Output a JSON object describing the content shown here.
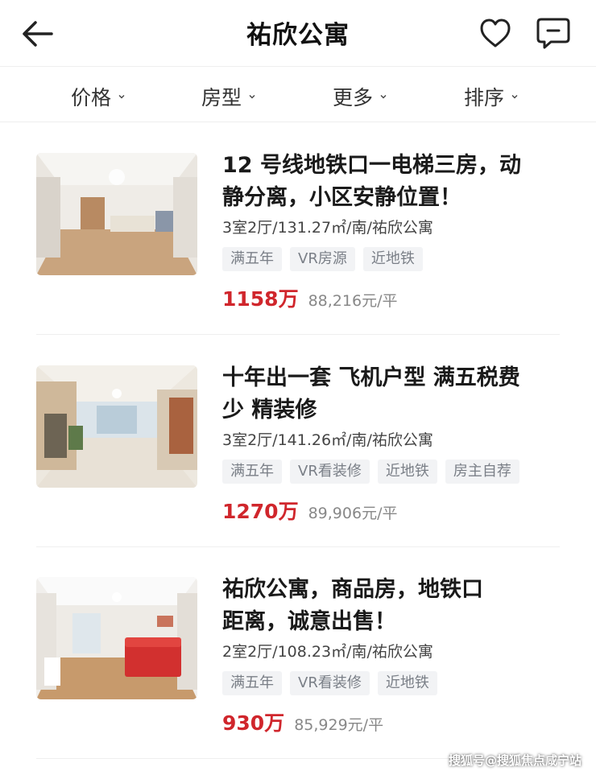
{
  "header": {
    "title": "祐欣公寓"
  },
  "filters": [
    {
      "label": "价格"
    },
    {
      "label": "房型"
    },
    {
      "label": "更多"
    },
    {
      "label": "排序"
    }
  ],
  "listings": [
    {
      "title_line1": "12 号线地铁口一电梯三房，动",
      "title_line2": "静分离，小区安静位置！",
      "meta": "3室2厅/131.27㎡/南/祐欣公寓",
      "tags": [
        "满五年",
        "VR房源",
        "近地铁"
      ],
      "price": "1158万",
      "unit_price": "88,216元/平"
    },
    {
      "title_line1": "十年出一套 飞机户型 满五税费",
      "title_line2": "少 精装修",
      "meta": "3室2厅/141.26㎡/南/祐欣公寓",
      "tags": [
        "满五年",
        "VR看装修",
        "近地铁",
        "房主自荐"
      ],
      "price": "1270万",
      "unit_price": "89,906元/平"
    },
    {
      "title_line1": "祐欣公寓，商品房，地铁口",
      "title_line2": "距离，诚意出售！",
      "meta": "2室2厅/108.23㎡/南/祐欣公寓",
      "tags": [
        "满五年",
        "VR看装修",
        "近地铁"
      ],
      "price": "930万",
      "unit_price": "85,929元/平"
    }
  ],
  "watermark": "搜狐号@搜狐焦点咸宁站",
  "colors": {
    "price": "#d0262c",
    "tag_bg": "#f2f3f5",
    "tag_text": "#7a7f87"
  }
}
